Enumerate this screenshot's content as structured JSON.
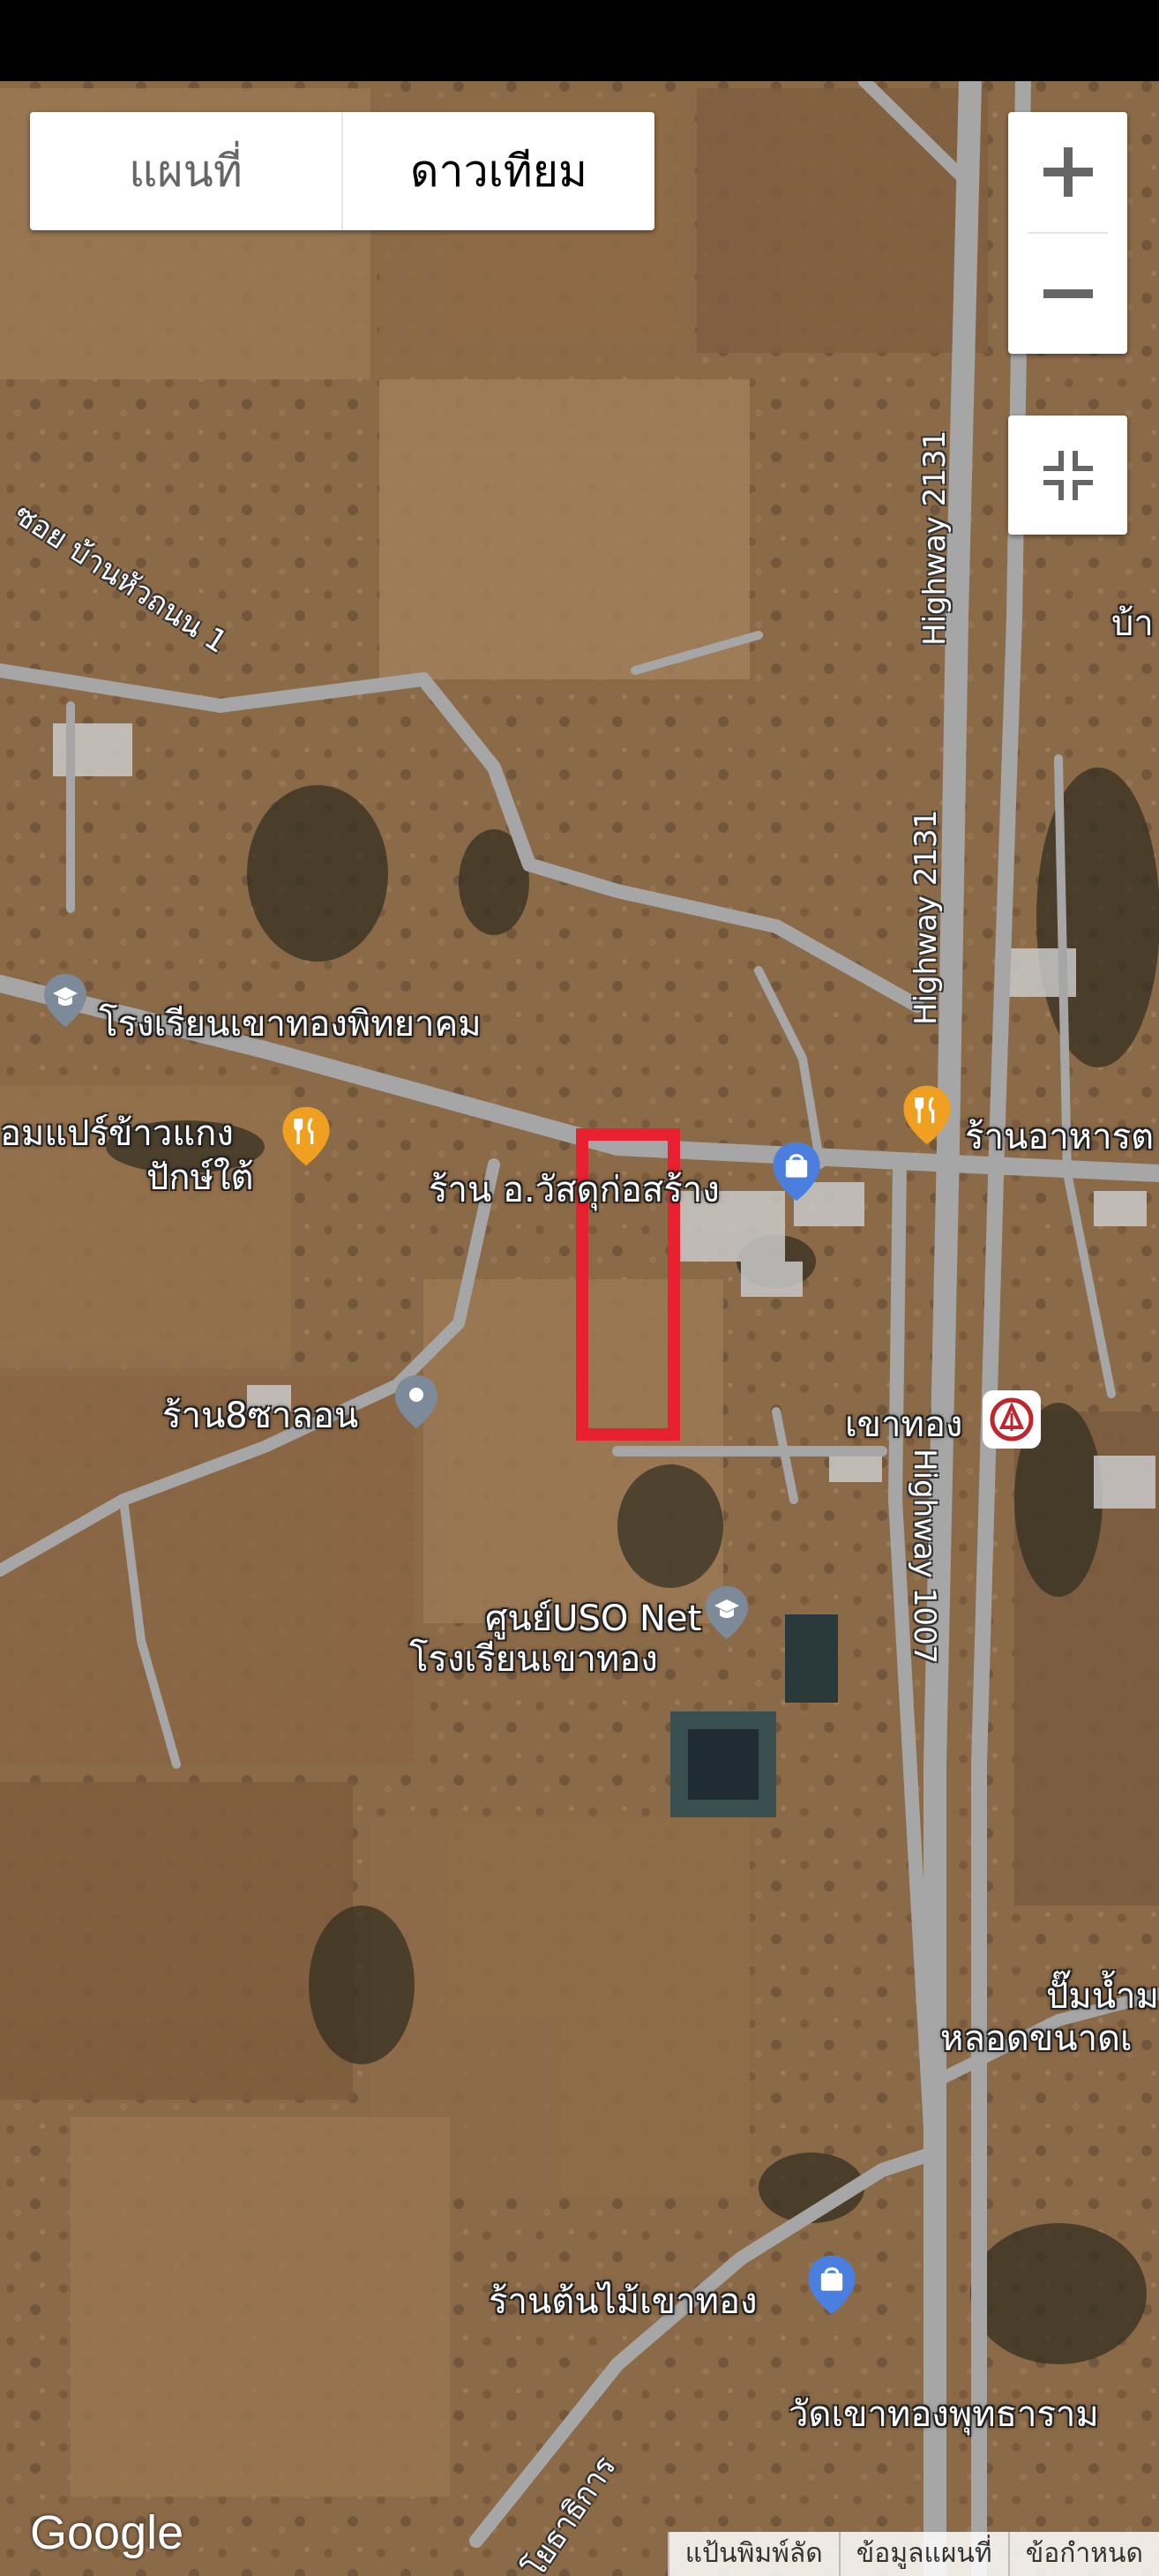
{
  "map_type": {
    "map_label": "แผนที่",
    "satellite_label": "ดาวเทียม",
    "active": "satellite"
  },
  "zoom": {
    "in_symbol": "+",
    "out_symbol": "−"
  },
  "places": [
    {
      "id": "school-khaothong-phitthayakhom",
      "label": "โรงเรียนเขาทองพิทยาคม",
      "icon": "school-icon"
    },
    {
      "id": "restaurant-left-line1",
      "label": "อมแปร์ข้าวแกง",
      "icon": "restaurant-icon"
    },
    {
      "id": "restaurant-left-line2",
      "label": "ปักษ์ใต้"
    },
    {
      "id": "construction-shop",
      "label": "ร้าน อ.วัสดุก่อสร้าง",
      "icon": "shopping-bag-icon"
    },
    {
      "id": "restaurant-right",
      "label": "ร้านอาหารต",
      "icon": "restaurant-icon"
    },
    {
      "id": "shop-8-salon",
      "label": "ร้าน8ซาลอน",
      "icon": "place-pin-icon"
    },
    {
      "id": "khaothong-station",
      "label": "เขาทอง",
      "icon": "railway-station-icon"
    },
    {
      "id": "uso-net-line1",
      "label": "ศูนย์USO Net",
      "icon": "school-icon"
    },
    {
      "id": "uso-net-line2",
      "label": "โรงเรียนเขาทอง"
    },
    {
      "id": "pump-line1",
      "label": "ปั๊มน้ำม"
    },
    {
      "id": "pump-line2",
      "label": "หลอดขนาดเ"
    },
    {
      "id": "tree-shop",
      "label": "ร้านต้นไม้เขาทอง",
      "icon": "shopping-bag-icon"
    },
    {
      "id": "temple",
      "label": "วัดเขาทองพุทธาราม"
    },
    {
      "id": "edge-right",
      "label": "บ้า"
    }
  ],
  "roads": {
    "soi_ban_hua_thanon": "ซอย บ้านหัวถนน 1",
    "highway_2131_a": "Highway 2131",
    "highway_2131_b": "Highway 2131",
    "highway_1007": "Highway 1007",
    "soi_yotha": "ซอย โยธาธิการ"
  },
  "footer": {
    "google": "Google",
    "keyboard_shortcuts": "แป้นพิมพ์ลัด",
    "map_data": "ข้อมูลแผนที่",
    "terms": "ข้อกำหนด"
  },
  "colors": {
    "highlight_box": "#e8202f",
    "road": "#a6a6a6",
    "pin_blue": "#4a7fe0",
    "pin_orange": "#f0a020",
    "pin_gray": "#7d8a99"
  }
}
